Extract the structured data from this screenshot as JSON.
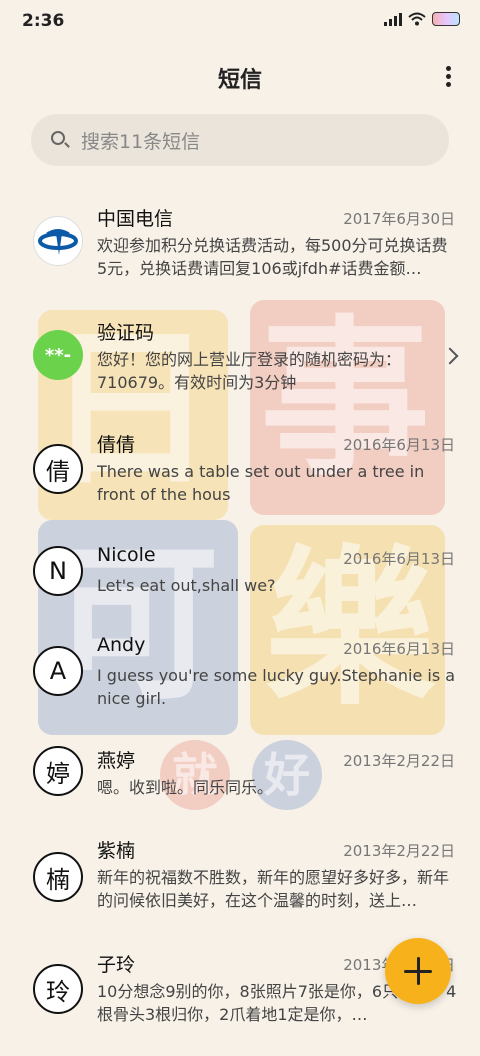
{
  "status_bar": {
    "time": "2:36"
  },
  "header": {
    "title": "短信",
    "more_icon": "more-vertical-icon"
  },
  "search": {
    "placeholder": "搜索11条短信"
  },
  "background": {
    "chars": [
      "日",
      "事",
      "可",
      "樂",
      "就",
      "好"
    ]
  },
  "conversations": [
    {
      "name": "中国电信",
      "date": "2017年6月30日",
      "preview": "欢迎参加积分兑换话费活动，每500分可兑换话费5元，兑换话费请回复106或jfdh#话费金额…",
      "avatar": "telecom-logo-icon"
    },
    {
      "name": "验证码",
      "date": "",
      "preview": "您好！您的网上营业厅登录的随机密码为：710679。有效时间为3分钟",
      "avatar_text": "**-"
    },
    {
      "name": "倩倩",
      "date": "2016年6月13日",
      "preview": "There was a table set out under a tree in front of the hous",
      "avatar_text": "倩"
    },
    {
      "name": "Nicole",
      "date": "2016年6月13日",
      "preview": "Let's eat out,shall we?",
      "avatar_text": "N"
    },
    {
      "name": "Andy",
      "date": "2016年6月13日",
      "preview": "I guess you're some lucky guy.Stephanie is a nice girl.",
      "avatar_text": "A"
    },
    {
      "name": "燕婷",
      "date": "2013年2月22日",
      "preview": "嗯。收到啦。同乐同乐。",
      "avatar_text": "婷"
    },
    {
      "name": "紫楠",
      "date": "2013年2月22日",
      "preview": "新年的祝福数不胜数，新年的愿望好多好多，新年的问候依旧美好，在这个温馨的时刻，送上…",
      "avatar_text": "楠"
    },
    {
      "name": "子玲",
      "date": "2013年2月22日",
      "preview": "10分想念9别的你，8张照片7张是你，6只像你，4根骨头3根归你，2爪着地1定是你，…",
      "avatar_text": "玲"
    }
  ],
  "fab": {
    "icon": "plus-icon"
  },
  "colors": {
    "fab": "#f7b21b",
    "verify_avatar": "#6ad24b",
    "background": "#f7f1e8"
  }
}
